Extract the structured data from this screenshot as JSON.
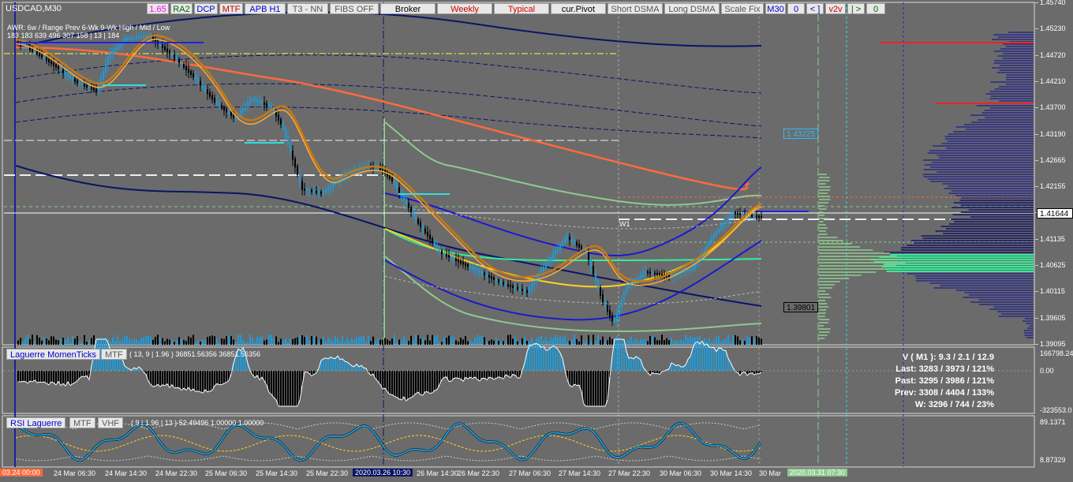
{
  "symbol": "USDCAD,M30",
  "toolbar": [
    {
      "label": "1.65",
      "color": "#ff00ff",
      "width": 28
    },
    {
      "label": "RA2",
      "color": "#006400",
      "width": 28
    },
    {
      "label": "DCP",
      "color": "#0000cc",
      "width": 30
    },
    {
      "label": "MTF",
      "color": "#cc0000",
      "width": 30
    },
    {
      "label": "APB H1",
      "color": "#0000cc",
      "width": 52
    },
    {
      "label": "T3 - NN",
      "color": "#555555",
      "width": 52
    },
    {
      "label": "FIBS OFF",
      "color": "#555555",
      "width": 62
    },
    {
      "label": "Broker",
      "color": "#000000",
      "width": 70
    },
    {
      "label": "Weekly",
      "color": "#cc0000",
      "width": 70
    },
    {
      "label": "Typical",
      "color": "#cc0000",
      "width": 70
    },
    {
      "label": "cur.Pivot",
      "color": "#000000",
      "width": 70
    },
    {
      "label": "Short DSMA",
      "color": "#555555",
      "width": 70
    },
    {
      "label": "Long DSMA",
      "color": "#555555",
      "width": 70
    },
    {
      "label": "Scale Fix",
      "color": "#555555",
      "width": 54
    },
    {
      "label": "M30",
      "color": "#0000cc",
      "width": 26
    },
    {
      "label": "0",
      "color": "#0000cc",
      "width": 22
    },
    {
      "label": "< ]",
      "color": "#0000cc",
      "width": 22
    },
    {
      "label": "v2v",
      "color": "#cc0000",
      "width": 26
    },
    {
      "label": "| >",
      "color": "#006400",
      "width": 22
    },
    {
      "label": "0",
      "color": "#006400",
      "width": 24
    }
  ],
  "awr": {
    "row1": "AWR: 6w / Range   Prev      6-Wk       9-Wk       High / Mid / Low",
    "row2": "           183       183       639       496       307       158  |  13  |  184"
  },
  "price_axis": [
    "1.45740",
    "1.45230",
    "1.44720",
    "1.44210",
    "1.43700",
    "1.43190",
    "1.42665",
    "1.42155",
    "1.41644",
    "1.41135",
    "1.40625",
    "1.40115",
    "1.39605",
    "1.39095"
  ],
  "price_boxes": {
    "current": "1.41644",
    "level_upper": "1.43225",
    "level_lower": "1.39801"
  },
  "week_label": "W1",
  "laguerre": {
    "title": "Laguerre MomenTicks",
    "mtf": "MTF",
    "params": "( 13, 9 | 1.96 ) 36851.56356 36851.56356",
    "axis": [
      "166798.24",
      "0.00",
      "-323553.0"
    ]
  },
  "rsi": {
    "title": "RSI Laguerre",
    "mtf": "MTF",
    "vhf": "VHF",
    "params": "( 9 | 1.96 | 13 ) 52.49496 1.00000 1.00000",
    "axis": [
      "89.1371",
      "8.87329"
    ]
  },
  "stats": [
    "V ( M1 ): 9.3 / 2.1 / 12.9",
    "Last: 3283 / 3973 / 121%",
    "Past: 3295 / 3986 / 121%",
    "Prev: 3308 / 4404 / 133%",
    "W: 3296 / 744 / 23%"
  ],
  "time_axis": {
    "start_box": "03.24 00:00",
    "ticks": [
      "24 Mar 06:30",
      "24 Mar 14:30",
      "24 Mar 22:30",
      "25 Mar 06:30",
      "25 Mar 14:30",
      "25 Mar 22:30",
      "26 Mar 14:30",
      "26 Mar 22:30",
      "27 Mar 06:30",
      "27 Mar 14:30",
      "27 Mar 22:30",
      "30 Mar 06:30",
      "30 Mar 14:30",
      "30 Mar"
    ],
    "highlight": "2020.03.26 10:30",
    "end_box": "2020.03.31 07:30"
  },
  "colors": {
    "background": "#6b6b6b",
    "bull_candle": "#1e9bd7",
    "bear_candle": "#000000",
    "orange_ma": "#ff6a3d",
    "navy_band": "#0a1466",
    "green_band": "#8fc98f",
    "yellow_line": "#ffd21e",
    "blue_band": "#1a1acc",
    "teal_line": "#33ee99"
  }
}
